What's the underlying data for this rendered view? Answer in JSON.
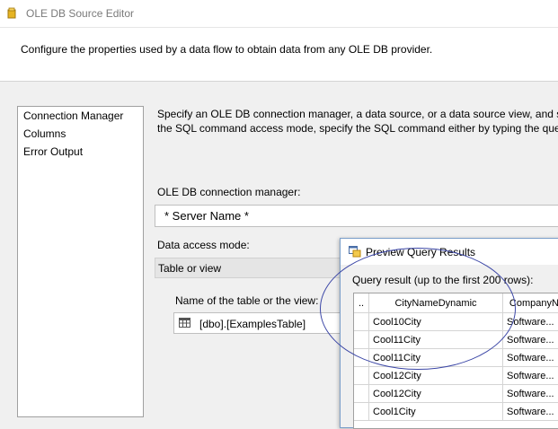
{
  "window": {
    "title": "OLE DB Source Editor",
    "icon": "ssis-package-icon"
  },
  "header": {
    "description": "Configure the properties used by a data flow to obtain data from any OLE DB provider."
  },
  "nav": {
    "items": [
      {
        "label": "Connection Manager"
      },
      {
        "label": "Columns"
      },
      {
        "label": "Error Output"
      }
    ]
  },
  "main": {
    "instructions_line1": "Specify an OLE DB connection manager, a data source, or a data source view, and sel",
    "instructions_line2": "the SQL command access mode, specify the SQL command either by typing the quer",
    "connection_label": "OLE DB connection manager:",
    "connection_value": "* Server Name *",
    "access_label": "Data access mode:",
    "access_value": "Table or view",
    "table_label": "Name of the table or the view:",
    "table_value": "[dbo].[ExamplesTable]"
  },
  "preview": {
    "title": "Preview Query Results",
    "query_label": "Query result (up to the first 200 rows):",
    "columns": [
      {
        "label": ".."
      },
      {
        "label": "CityNameDynamic"
      },
      {
        "label": "CompanyN..."
      }
    ],
    "rows": [
      {
        "city": "Cool10City",
        "company": "Software..."
      },
      {
        "city": "Cool11City",
        "company": "Software..."
      },
      {
        "city": "Cool11City",
        "company": "Software..."
      },
      {
        "city": "Cool12City",
        "company": "Software..."
      },
      {
        "city": "Cool12City",
        "company": "Software..."
      },
      {
        "city": "Cool1City",
        "company": "Software..."
      }
    ]
  },
  "annotation": {
    "ellipse_color": "#3b46a6"
  }
}
